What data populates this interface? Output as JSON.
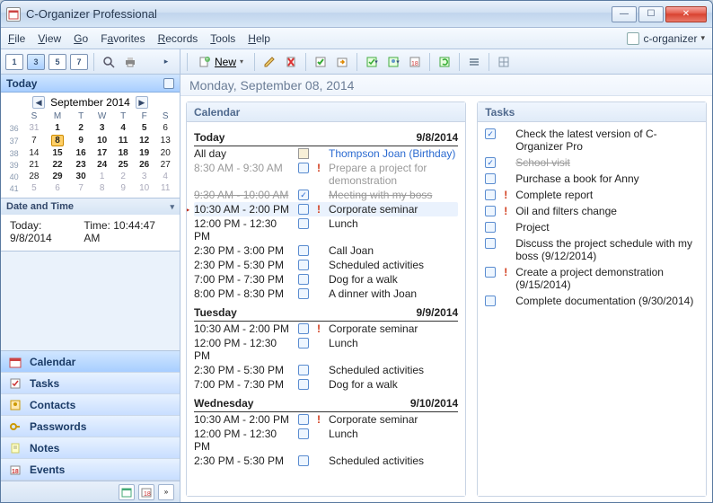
{
  "titlebar": {
    "title": "C-Organizer Professional"
  },
  "menu": {
    "file": "File",
    "view": "View",
    "go": "Go",
    "favorites": "Favorites",
    "records": "Records",
    "tools": "Tools",
    "help": "Help",
    "project": "c-organizer"
  },
  "left_toolbar": {
    "d1": "1",
    "d3": "3",
    "d5": "5",
    "d7": "7"
  },
  "right_toolbar": {
    "new": "New"
  },
  "today_header": "Today",
  "minical": {
    "month": "September 2014",
    "dow": [
      "S",
      "M",
      "T",
      "W",
      "T",
      "F",
      "S"
    ],
    "weeks": [
      {
        "w": "36",
        "d": [
          {
            "n": "31",
            "om": true
          },
          {
            "n": "1",
            "b": true
          },
          {
            "n": "2",
            "b": true
          },
          {
            "n": "3",
            "b": true
          },
          {
            "n": "4",
            "b": true
          },
          {
            "n": "5",
            "b": true
          },
          {
            "n": "6"
          }
        ]
      },
      {
        "w": "37",
        "d": [
          {
            "n": "7"
          },
          {
            "n": "8",
            "b": true,
            "today": true
          },
          {
            "n": "9",
            "b": true
          },
          {
            "n": "10",
            "b": true
          },
          {
            "n": "11",
            "b": true
          },
          {
            "n": "12",
            "b": true
          },
          {
            "n": "13"
          }
        ]
      },
      {
        "w": "38",
        "d": [
          {
            "n": "14"
          },
          {
            "n": "15",
            "b": true
          },
          {
            "n": "16",
            "b": true
          },
          {
            "n": "17",
            "b": true
          },
          {
            "n": "18",
            "b": true
          },
          {
            "n": "19",
            "b": true
          },
          {
            "n": "20"
          }
        ]
      },
      {
        "w": "39",
        "d": [
          {
            "n": "21"
          },
          {
            "n": "22",
            "b": true
          },
          {
            "n": "23",
            "b": true
          },
          {
            "n": "24",
            "b": true
          },
          {
            "n": "25",
            "b": true
          },
          {
            "n": "26",
            "b": true
          },
          {
            "n": "27"
          }
        ]
      },
      {
        "w": "40",
        "d": [
          {
            "n": "28"
          },
          {
            "n": "29",
            "b": true
          },
          {
            "n": "30",
            "b": true
          },
          {
            "n": "1",
            "om": true
          },
          {
            "n": "2",
            "om": true
          },
          {
            "n": "3",
            "om": true
          },
          {
            "n": "4",
            "om": true
          }
        ]
      },
      {
        "w": "41",
        "d": [
          {
            "n": "5",
            "om": true
          },
          {
            "n": "6",
            "om": true
          },
          {
            "n": "7",
            "om": true
          },
          {
            "n": "8",
            "om": true
          },
          {
            "n": "9",
            "om": true
          },
          {
            "n": "10",
            "om": true
          },
          {
            "n": "11",
            "om": true
          }
        ]
      }
    ]
  },
  "datetime": {
    "header": "Date and Time",
    "today": "Today: 9/8/2014",
    "time": "Time: 10:44:47 AM"
  },
  "nav": [
    {
      "label": "Calendar",
      "icon": "calendar",
      "sel": true
    },
    {
      "label": "Tasks",
      "icon": "tasks"
    },
    {
      "label": "Contacts",
      "icon": "contacts"
    },
    {
      "label": "Passwords",
      "icon": "passwords"
    },
    {
      "label": "Notes",
      "icon": "notes"
    },
    {
      "label": "Events",
      "icon": "events"
    }
  ],
  "date_header": "Monday, September 08, 2014",
  "calendar": {
    "title": "Calendar",
    "days": [
      {
        "name": "Today",
        "date": "9/8/2014",
        "events": [
          {
            "time": "All day",
            "link": true,
            "bd": true,
            "text": "Thompson Joan (Birthday)"
          },
          {
            "time": "8:30 AM - 9:30 AM",
            "gray": true,
            "pri": true,
            "text": "Prepare a project for demonstration",
            "textgray": true
          },
          {
            "time": "9:30 AM - 10:00 AM",
            "strike": true,
            "done": true,
            "text": "Meeting with my boss",
            "textstrike": true
          },
          {
            "time": "10:30 AM - 2:00 PM",
            "marker": true,
            "hl": true,
            "pri": true,
            "text": "Corporate seminar"
          },
          {
            "time": "12:00 PM - 12:30 PM",
            "text": "Lunch"
          },
          {
            "time": "2:30 PM - 3:00 PM",
            "text": "Call Joan"
          },
          {
            "time": "2:30 PM - 5:30 PM",
            "text": "Scheduled activities"
          },
          {
            "time": "7:00 PM - 7:30 PM",
            "text": "Dog for a walk"
          },
          {
            "time": "8:00 PM - 8:30 PM",
            "text": "A dinner with Joan"
          }
        ]
      },
      {
        "name": "Tuesday",
        "date": "9/9/2014",
        "events": [
          {
            "time": "10:30 AM - 2:00 PM",
            "pri": true,
            "text": "Corporate seminar"
          },
          {
            "time": "12:00 PM - 12:30 PM",
            "text": "Lunch"
          },
          {
            "time": "2:30 PM - 5:30 PM",
            "text": "Scheduled activities"
          },
          {
            "time": "7:00 PM - 7:30 PM",
            "text": "Dog for a walk"
          }
        ]
      },
      {
        "name": "Wednesday",
        "date": "9/10/2014",
        "events": [
          {
            "time": "10:30 AM - 2:00 PM",
            "pri": true,
            "text": "Corporate seminar"
          },
          {
            "time": "12:00 PM - 12:30 PM",
            "text": "Lunch"
          },
          {
            "time": "2:30 PM - 5:30 PM",
            "text": "Scheduled activities"
          }
        ]
      }
    ]
  },
  "tasks": {
    "title": "Tasks",
    "items": [
      {
        "done": true,
        "text": "Check the latest version of C-Organizer Pro"
      },
      {
        "done": true,
        "strike": true,
        "text": "School visit"
      },
      {
        "text": "Purchase a book for Anny"
      },
      {
        "pri": true,
        "text": "Complete report"
      },
      {
        "pri": true,
        "text": "Oil and filters change"
      },
      {
        "text": "Project"
      },
      {
        "text": "Discuss the project schedule with my boss (9/12/2014)"
      },
      {
        "pri": true,
        "text": "Create a project demonstration (9/15/2014)"
      },
      {
        "text": "Complete documentation (9/30/2014)"
      }
    ]
  }
}
